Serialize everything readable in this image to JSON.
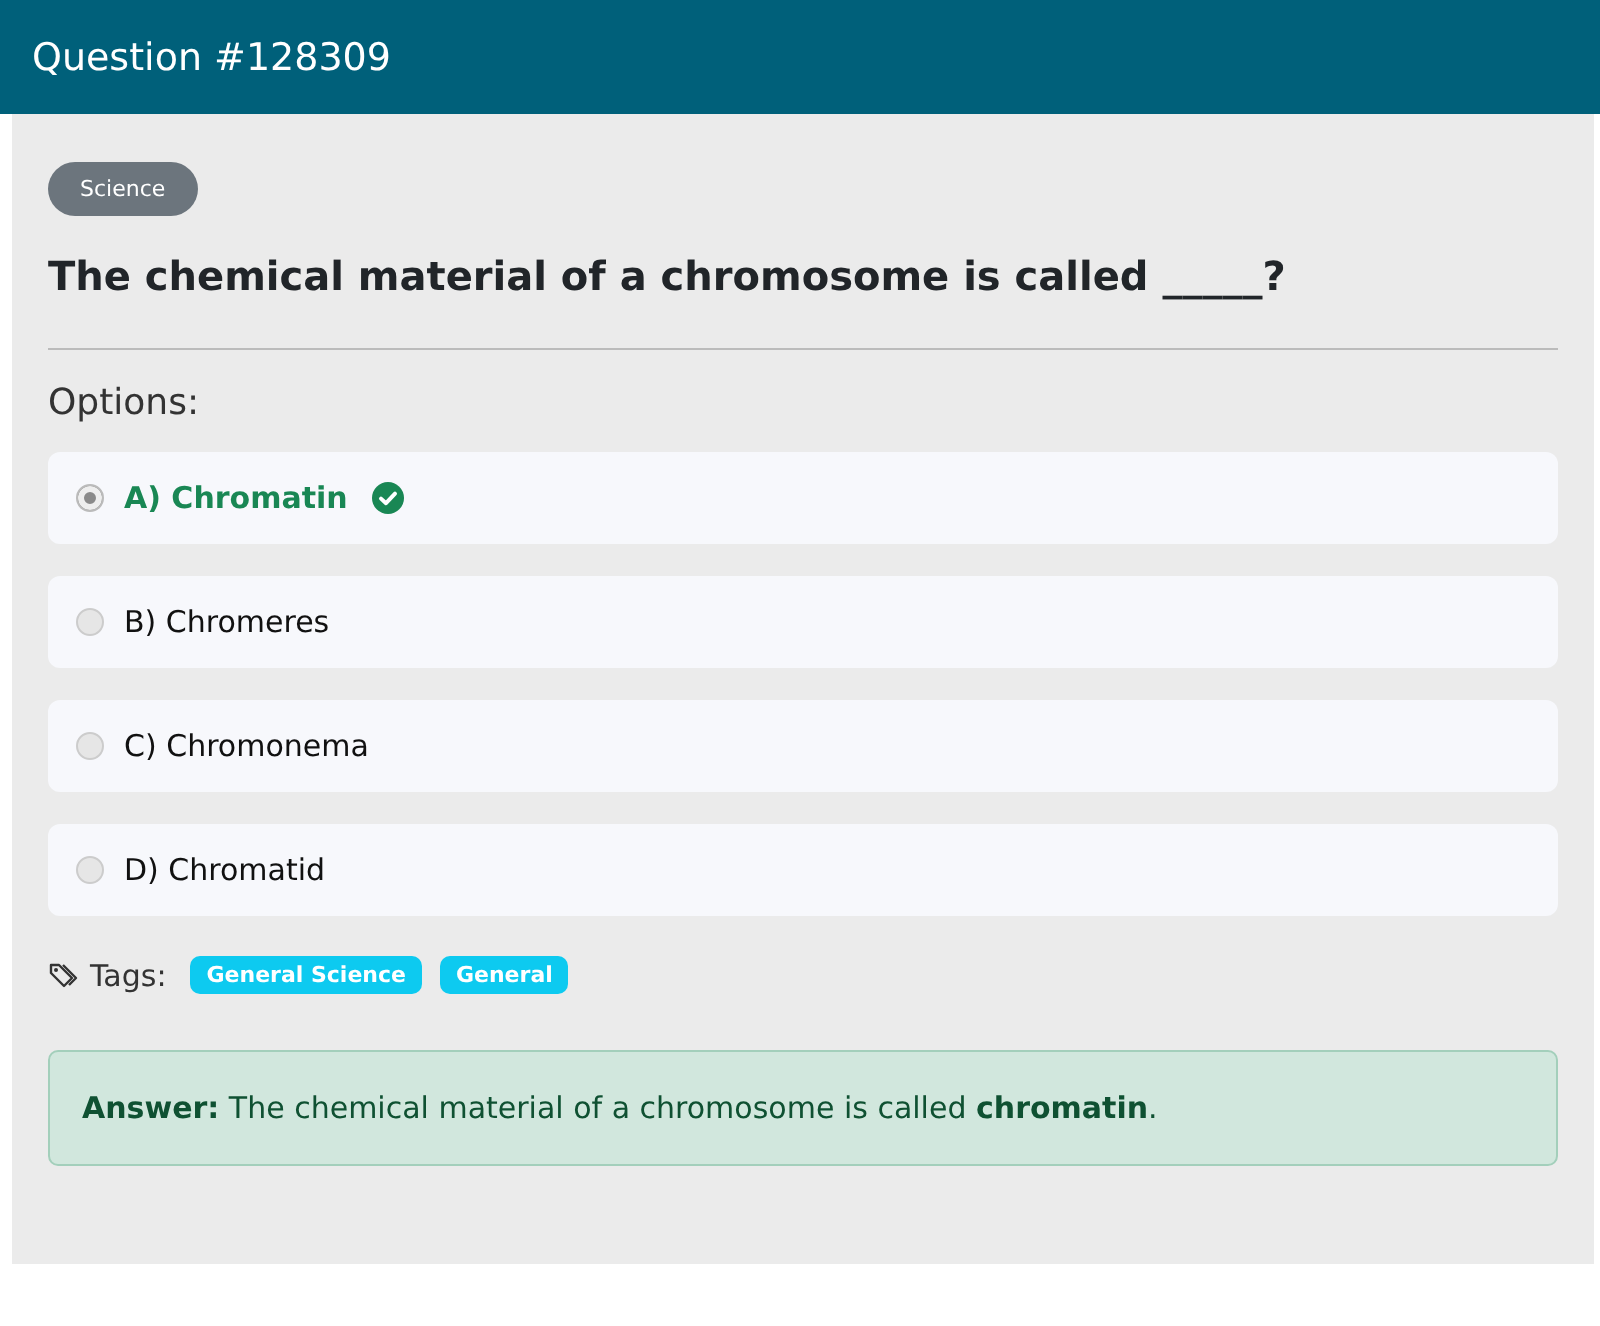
{
  "header": {
    "title": "Question #128309"
  },
  "category": "Science",
  "question": "The chemical material of a chromosome is called _____?",
  "options_label": "Options:",
  "options": [
    {
      "label": "A) Chromatin",
      "selected": true,
      "correct": true
    },
    {
      "label": "B) Chromeres",
      "selected": false,
      "correct": false
    },
    {
      "label": "C) Chromonema",
      "selected": false,
      "correct": false
    },
    {
      "label": "D) Chromatid",
      "selected": false,
      "correct": false
    }
  ],
  "tags_label": "Tags:",
  "tags": [
    "General Science",
    "General"
  ],
  "answer": "**Answer:** The chemical material of a chromosome is called **chromatin**."
}
